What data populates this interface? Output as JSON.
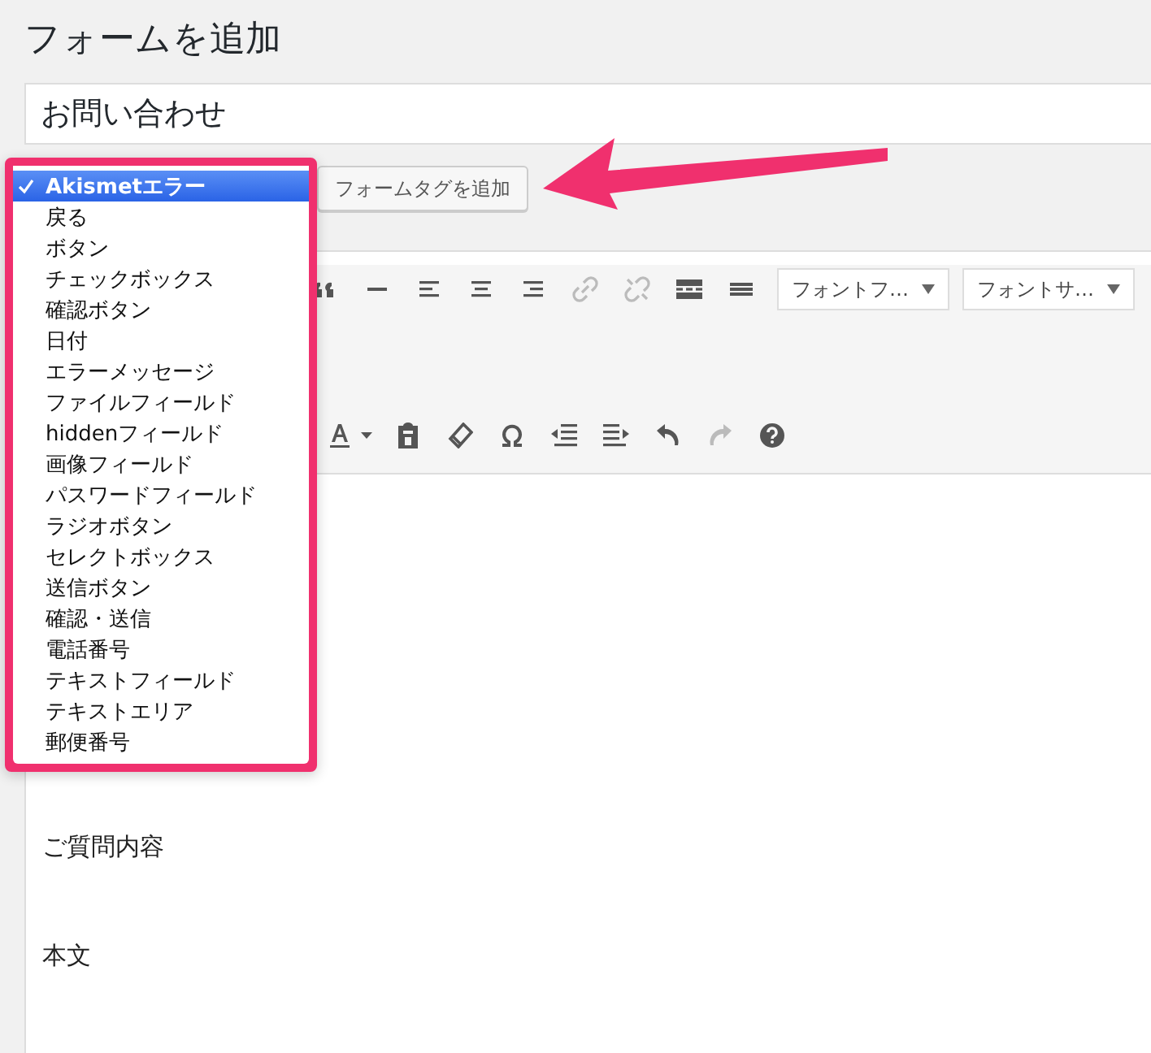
{
  "page_title": "フォームを追加",
  "form_name": {
    "value": "お問い合わせ"
  },
  "add_tag_button": {
    "label": "フォームタグを追加"
  },
  "tag_menu": {
    "items": [
      {
        "label": "Akismetエラー",
        "selected": true
      },
      {
        "label": "戻る",
        "selected": false
      },
      {
        "label": "ボタン",
        "selected": false
      },
      {
        "label": "チェックボックス",
        "selected": false
      },
      {
        "label": "確認ボタン",
        "selected": false
      },
      {
        "label": "日付",
        "selected": false
      },
      {
        "label": "エラーメッセージ",
        "selected": false
      },
      {
        "label": "ファイルフィールド",
        "selected": false
      },
      {
        "label": "hiddenフィールド",
        "selected": false
      },
      {
        "label": "画像フィールド",
        "selected": false
      },
      {
        "label": "パスワードフィールド",
        "selected": false
      },
      {
        "label": "ラジオボタン",
        "selected": false
      },
      {
        "label": "セレクトボックス",
        "selected": false
      },
      {
        "label": "送信ボタン",
        "selected": false
      },
      {
        "label": "確認・送信",
        "selected": false
      },
      {
        "label": "電話番号",
        "selected": false
      },
      {
        "label": "テキストフィールド",
        "selected": false
      },
      {
        "label": "テキストエリア",
        "selected": false
      },
      {
        "label": "郵便番号",
        "selected": false
      }
    ]
  },
  "toolbar_row_1": [
    {
      "kind": "quote",
      "disabled": false
    },
    {
      "kind": "hr",
      "disabled": false
    },
    {
      "kind": "align-left",
      "disabled": false
    },
    {
      "kind": "align-center",
      "disabled": false
    },
    {
      "kind": "align-right",
      "disabled": false
    },
    {
      "kind": "link",
      "disabled": true
    },
    {
      "kind": "unlink",
      "disabled": true
    },
    {
      "kind": "more",
      "disabled": false
    },
    {
      "kind": "toolbar",
      "disabled": false
    }
  ],
  "font_selects": [
    {
      "label": "フォントフ…"
    },
    {
      "label": "フォントサ…"
    }
  ],
  "toolbar_row_3": [
    {
      "kind": "text-color",
      "disabled": false
    },
    {
      "kind": "paste",
      "disabled": false
    },
    {
      "kind": "eraser",
      "disabled": false
    },
    {
      "kind": "omega",
      "disabled": false
    },
    {
      "kind": "outdent",
      "disabled": false
    },
    {
      "kind": "indent",
      "disabled": false
    },
    {
      "kind": "undo",
      "disabled": false
    },
    {
      "kind": "redo",
      "disabled": true
    },
    {
      "kind": "help",
      "disabled": false
    }
  ],
  "editor_lines": [
    "ご質問内容",
    "本文"
  ]
}
